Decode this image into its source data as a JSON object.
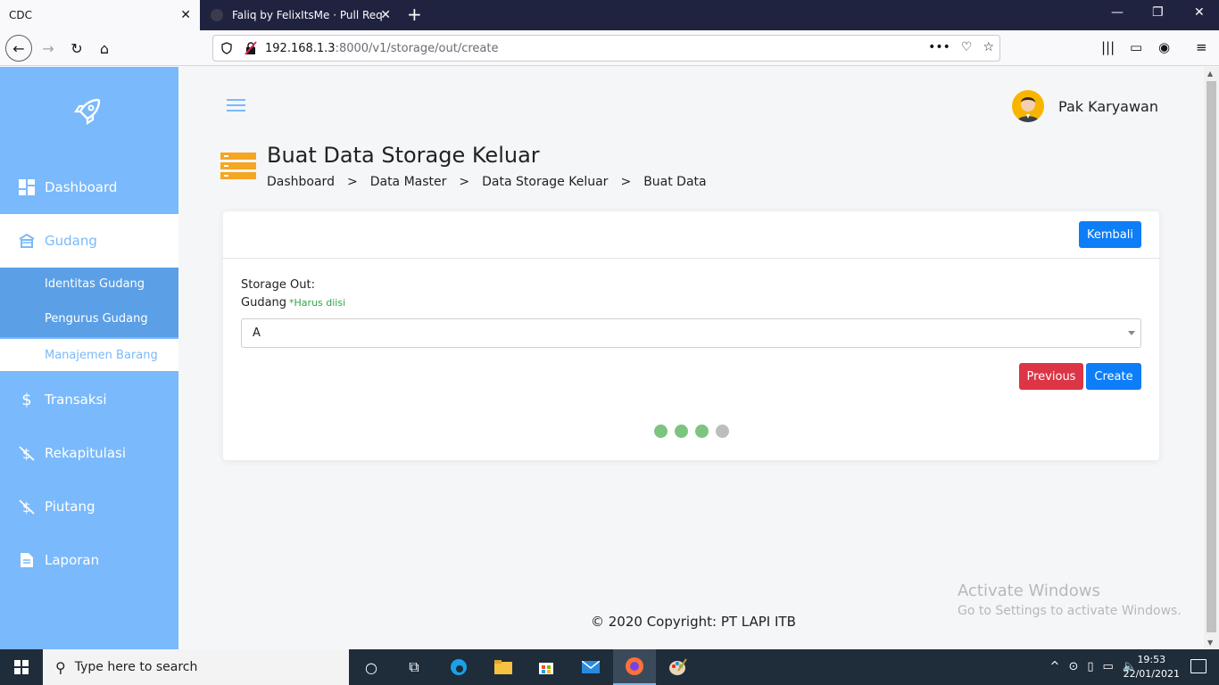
{
  "browser": {
    "tabs": [
      {
        "label": "CDC",
        "active": true
      },
      {
        "label": "Faliq by FelixItsMe · Pull Reque",
        "active": false
      }
    ],
    "url_host": "192.168.1.3",
    "url_path": ":8000/v1/storage/out/create",
    "more_icon": "•••"
  },
  "sidebar": {
    "items": [
      {
        "label": "Dashboard",
        "icon": "dashboard-icon"
      },
      {
        "label": "Gudang",
        "icon": "warehouse-icon"
      },
      {
        "label": "Transaksi",
        "icon": "dollar-icon"
      },
      {
        "label": "Rekapitulasi",
        "icon": "dollar-slash-icon"
      },
      {
        "label": "Piutang",
        "icon": "dollar-slash-icon"
      },
      {
        "label": "Laporan",
        "icon": "document-icon"
      }
    ],
    "subitems": [
      {
        "label": "Identitas Gudang"
      },
      {
        "label": "Pengurus Gudang"
      },
      {
        "label": "Manajemen Barang"
      }
    ],
    "accent": "#7ab9fb"
  },
  "header": {
    "username": "Pak Karyawan"
  },
  "page": {
    "title": "Buat Data Storage Keluar",
    "breadcrumb": [
      "Dashboard",
      ">",
      "Data Master",
      ">",
      "Data Storage Keluar",
      ">",
      "Buat Data"
    ]
  },
  "form": {
    "back_label": "Kembali",
    "section_label": "Storage Out:",
    "gudang_label": "Gudang",
    "required_note": "*Harus diisi",
    "gudang_value": "A",
    "previous_label": "Previous",
    "create_label": "Create",
    "steps_total": 4,
    "steps_done": 3
  },
  "footer": {
    "copyright": "© 2020 Copyright: PT LAPI ITB"
  },
  "watermark": {
    "title": "Activate Windows",
    "subtitle": "Go to Settings to activate Windows."
  },
  "taskbar": {
    "search_placeholder": "Type here to search",
    "time": "19:53",
    "date": "22/01/2021"
  }
}
